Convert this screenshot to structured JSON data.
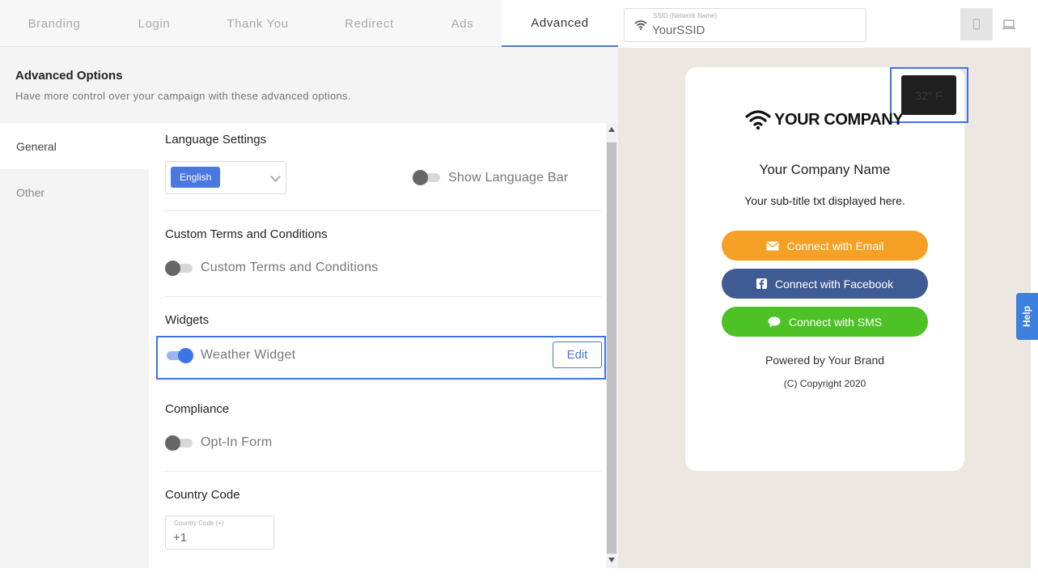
{
  "tabs": [
    {
      "label": "Branding"
    },
    {
      "label": "Login"
    },
    {
      "label": "Thank You"
    },
    {
      "label": "Redirect"
    },
    {
      "label": "Ads"
    },
    {
      "label": "Advanced"
    }
  ],
  "header": {
    "title": "Advanced Options",
    "subtitle": "Have more control over your campaign with these advanced options."
  },
  "sidebar": {
    "items": [
      {
        "label": "General"
      },
      {
        "label": "Other"
      }
    ]
  },
  "language": {
    "title": "Language Settings",
    "selected": "English",
    "bar_label": "Show Language Bar",
    "bar_on": false
  },
  "terms": {
    "title": "Custom Terms and Conditions",
    "toggle_label": "Custom Terms and Conditions",
    "on": false
  },
  "widgets": {
    "title": "Widgets",
    "weather_label": "Weather Widget",
    "weather_on": true,
    "edit_label": "Edit"
  },
  "compliance": {
    "title": "Compliance",
    "optin_label": "Opt-In Form",
    "on": false
  },
  "country": {
    "title": "Country Code",
    "field_label": "Country Code (+)",
    "value": "+1"
  },
  "ssid": {
    "label": "SSID (Network Name)",
    "value": "YourSSID"
  },
  "preview": {
    "weather": "32° F",
    "logo_text": "YOUR COMPANY",
    "company_name": "Your Company Name",
    "subtitle": "Your sub-title txt displayed here.",
    "buttons": {
      "email": "Connect with Email",
      "facebook": "Connect with Facebook",
      "sms": "Connect with SMS"
    },
    "powered": "Powered by Your Brand",
    "copyright": "(C) Copyright 2020"
  },
  "help": "Help",
  "colors": {
    "accent": "#3d74e8",
    "email": "#f6a025",
    "facebook": "#3f5b94",
    "sms": "#4cc227"
  }
}
